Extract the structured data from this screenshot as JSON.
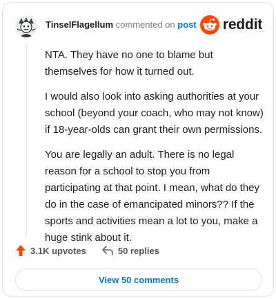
{
  "header": {
    "username": "TinselFlagellum",
    "action_text": "commented on",
    "post_link": "post",
    "brand": "reddit"
  },
  "comment": {
    "paragraphs": [
      "NTA. They have no one to blame but themselves for how it turned out.",
      "I would also look into asking authorities at your school (beyond your coach, who may not know) if 18-year-olds can grant their own permissions.",
      "You are legally an adult. There is no legal reason for a school to stop you from participating at that point. I mean, what do they do in the case of emancipated minors?? If the sports and activities mean a lot to you, make a huge stink about it."
    ]
  },
  "actions": {
    "upvotes": "3.1K upvotes",
    "replies": "50 replies"
  },
  "footer": {
    "view_comments": "View 50 comments"
  },
  "colors": {
    "brand_orange": "#ff4500",
    "link_blue": "#0079d3",
    "upvote_orange": "#ff4500"
  },
  "icons": {
    "avatar": "avatar-icon",
    "brand": "reddit-logo-icon",
    "upvote": "upvote-arrow-icon",
    "reply": "reply-arrow-icon"
  }
}
